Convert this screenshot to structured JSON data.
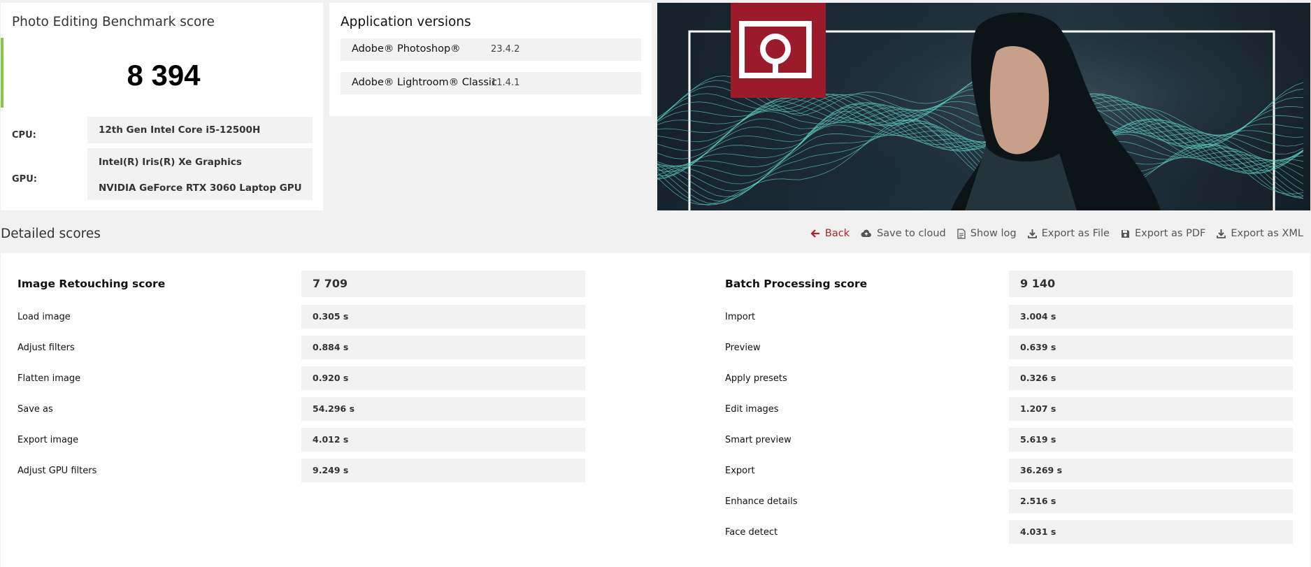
{
  "summary": {
    "title": "Photo Editing Benchmark score",
    "score": "8 394",
    "cpu_label": "CPU:",
    "cpu_value": "12th Gen Intel Core i5-12500H",
    "gpu_label": "GPU:",
    "gpu_values": [
      "Intel(R) Iris(R) Xe Graphics",
      "NVIDIA GeForce RTX 3060 Laptop GPU"
    ]
  },
  "versions": {
    "title": "Application versions",
    "apps": [
      {
        "name": "Adobe® Photoshop®",
        "version": "23.4.2"
      },
      {
        "name": "Adobe® Lightroom® Classic",
        "version": "11.4.1"
      }
    ]
  },
  "detailed": {
    "title": "Detailed scores",
    "actions": [
      {
        "label": "Back",
        "icon": "arrow-left-icon"
      },
      {
        "label": "Save to cloud",
        "icon": "cloud-upload-icon"
      },
      {
        "label": "Show log",
        "icon": "document-icon"
      },
      {
        "label": "Export as File",
        "icon": "download-icon"
      },
      {
        "label": "Export as PDF",
        "icon": "floppy-disk-icon"
      },
      {
        "label": "Export as XML",
        "icon": "download-icon"
      }
    ],
    "image_retouching": {
      "label": "Image Retouching score",
      "score": "7 709",
      "rows": [
        {
          "label": "Load image",
          "value": "0.305 s"
        },
        {
          "label": "Adjust filters",
          "value": "0.884 s"
        },
        {
          "label": "Flatten image",
          "value": "0.920 s"
        },
        {
          "label": "Save as",
          "value": "54.296 s"
        },
        {
          "label": "Export image",
          "value": "4.012 s"
        },
        {
          "label": "Adjust GPU filters",
          "value": "9.249 s"
        }
      ]
    },
    "batch_processing": {
      "label": "Batch Processing score",
      "score": "9 140",
      "rows": [
        {
          "label": "Import",
          "value": "3.004 s"
        },
        {
          "label": "Preview",
          "value": "0.639 s"
        },
        {
          "label": "Apply presets",
          "value": "0.326 s"
        },
        {
          "label": "Edit images",
          "value": "1.207 s"
        },
        {
          "label": "Smart preview",
          "value": "5.619 s"
        },
        {
          "label": "Export",
          "value": "36.269 s"
        },
        {
          "label": "Enhance details",
          "value": "2.516 s"
        },
        {
          "label": "Face detect",
          "value": "4.031 s"
        }
      ]
    }
  },
  "colors": {
    "accent_green": "#8bc34a",
    "back_red": "#b0202e",
    "logo_red": "#9b1b2a",
    "wave_teal": "#5fd3c4"
  }
}
